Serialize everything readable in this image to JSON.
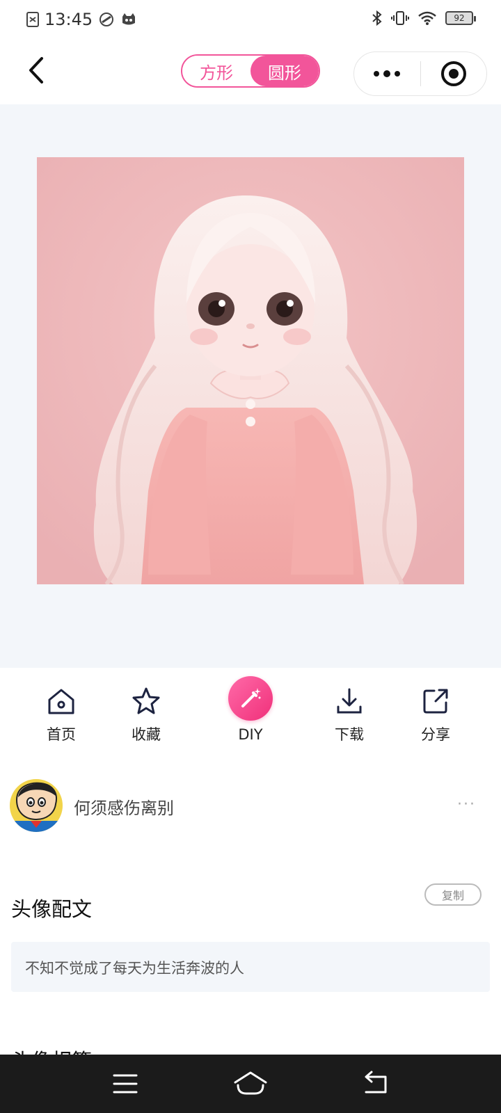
{
  "status_bar": {
    "time": "13:45",
    "battery": "92"
  },
  "nav": {
    "shape_square": "方形",
    "shape_round": "圆形",
    "selected_shape": "round"
  },
  "actions": {
    "home": "首页",
    "favorite": "收藏",
    "diy": "DIY",
    "download": "下载",
    "share": "分享"
  },
  "author": {
    "name": "何须感伤离别",
    "more": "···"
  },
  "caption_section": {
    "title": "头像配文",
    "copy": "复制",
    "text": "不知不觉成了每天为生活奔波的人"
  },
  "next_section": {
    "title": "头像相簿"
  },
  "colors": {
    "accent": "#f2559a",
    "stage_bg": "#f3f6fa",
    "image_bg": "#efb6b8"
  }
}
